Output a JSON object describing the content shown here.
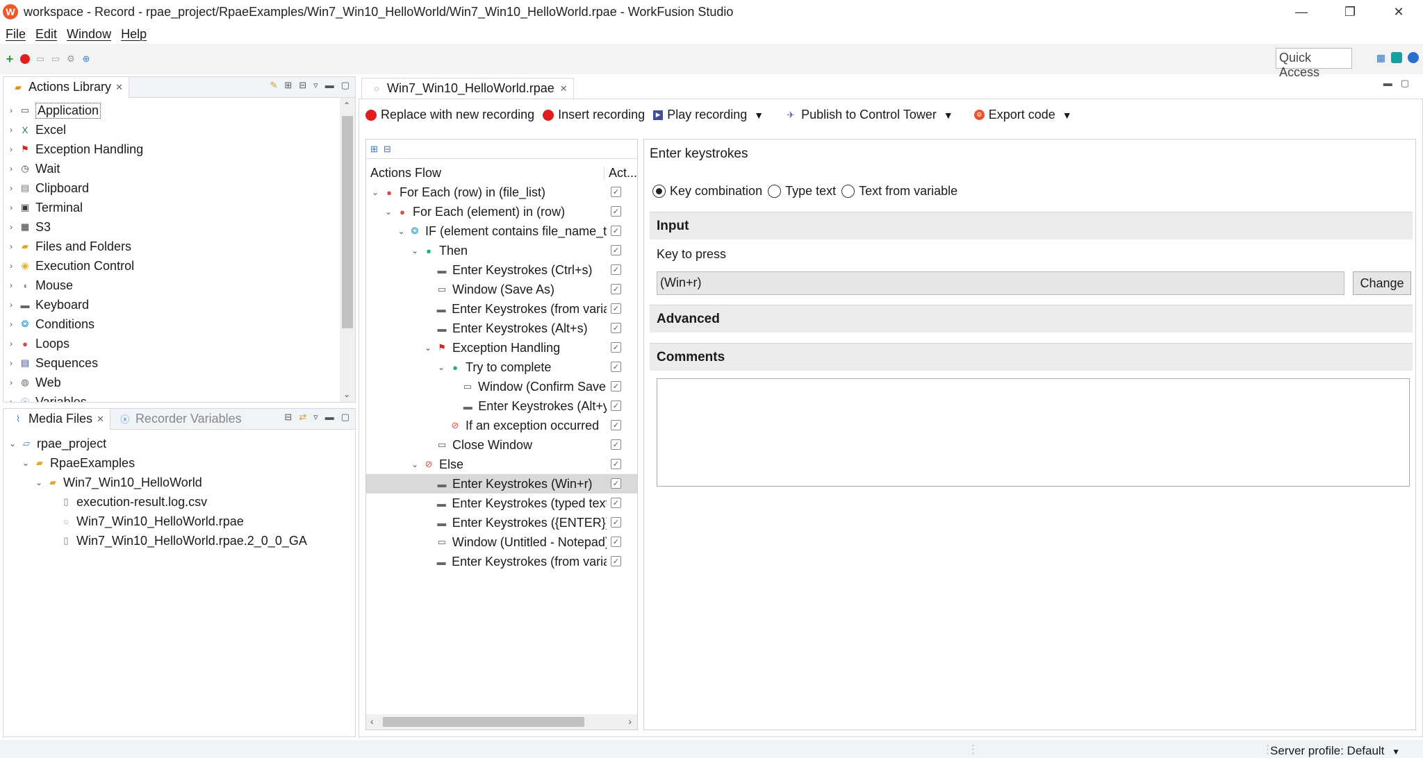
{
  "window": {
    "title": "workspace - Record - rpae_project/RpaeExamples/Win7_Win10_HelloWorld/Win7_Win10_HelloWorld.rpae - WorkFusion Studio",
    "logo_letter": "W",
    "minimize": "—",
    "maximize": "❐",
    "close": "✕"
  },
  "menu": [
    "File",
    "Edit",
    "Window",
    "Help"
  ],
  "toolbar": {
    "quick_access": "Quick Access"
  },
  "actions_library": {
    "tab_label": "Actions Library",
    "items": [
      {
        "label": "Application",
        "icon": "application-icon"
      },
      {
        "label": "Excel",
        "icon": "excel-icon"
      },
      {
        "label": "Exception Handling",
        "icon": "flag-icon"
      },
      {
        "label": "Wait",
        "icon": "clock-icon"
      },
      {
        "label": "Clipboard",
        "icon": "clipboard-icon"
      },
      {
        "label": "Terminal",
        "icon": "terminal-icon"
      },
      {
        "label": "S3",
        "icon": "s3-icon"
      },
      {
        "label": "Files and Folders",
        "icon": "folder-icon"
      },
      {
        "label": "Execution Control",
        "icon": "execution-icon"
      },
      {
        "label": "Mouse",
        "icon": "mouse-icon"
      },
      {
        "label": "Keyboard",
        "icon": "keyboard-icon"
      },
      {
        "label": "Conditions",
        "icon": "conditions-icon"
      },
      {
        "label": "Loops",
        "icon": "loop-icon"
      },
      {
        "label": "Sequences",
        "icon": "sequence-icon"
      },
      {
        "label": "Web",
        "icon": "globe-icon"
      },
      {
        "label": "Variables",
        "icon": "variables-icon"
      }
    ]
  },
  "media_files": {
    "tab_label": "Media Files",
    "tab2_label": "Recorder Variables",
    "tree": [
      {
        "label": "rpae_project",
        "depth": 0,
        "icon": "project-folder-icon",
        "twisty": "⌄"
      },
      {
        "label": "RpaeExamples",
        "depth": 1,
        "icon": "folder-icon",
        "twisty": "⌄"
      },
      {
        "label": "Win7_Win10_HelloWorld",
        "depth": 2,
        "icon": "folder-icon",
        "twisty": "⌄"
      },
      {
        "label": "execution-result.log.csv",
        "depth": 3,
        "icon": "file-icon",
        "twisty": ""
      },
      {
        "label": "Win7_Win10_HelloWorld.rpae",
        "depth": 3,
        "icon": "rpae-file-icon",
        "twisty": ""
      },
      {
        "label": "Win7_Win10_HelloWorld.rpae.2_0_0_GA",
        "depth": 3,
        "icon": "file-icon",
        "twisty": ""
      }
    ]
  },
  "editor": {
    "tab_label": "Win7_Win10_HelloWorld.rpae",
    "actions": {
      "replace": "Replace with new recording",
      "insert": "Insert recording",
      "play": "Play recording",
      "publish": "Publish to Control Tower",
      "export": "Export code"
    }
  },
  "flow": {
    "header_name": "Actions Flow",
    "header_active": "Act...",
    "rows": [
      {
        "label": "For Each (row) in (file_list)",
        "depth": 0,
        "twisty": "⌄",
        "icon": "loop-icon",
        "checked": true
      },
      {
        "label": "For Each (element) in (row)",
        "depth": 1,
        "twisty": "⌄",
        "icon": "loop-icon",
        "checked": true
      },
      {
        "label": "IF (element contains file_name_ten",
        "depth": 2,
        "twisty": "⌄",
        "icon": "conditions-icon",
        "checked": true
      },
      {
        "label": "Then",
        "depth": 3,
        "twisty": "⌄",
        "icon": "then-icon",
        "checked": true
      },
      {
        "label": "Enter Keystrokes (Ctrl+s)",
        "depth": 4,
        "twisty": "",
        "icon": "keyboard-icon",
        "checked": true
      },
      {
        "label": "Window (Save As)",
        "depth": 4,
        "twisty": "",
        "icon": "window-icon",
        "checked": true
      },
      {
        "label": "Enter Keystrokes (from variab",
        "depth": 4,
        "twisty": "",
        "icon": "keyboard-icon",
        "checked": true
      },
      {
        "label": "Enter Keystrokes (Alt+s)",
        "depth": 4,
        "twisty": "",
        "icon": "keyboard-icon",
        "checked": true
      },
      {
        "label": "Exception Handling",
        "depth": 4,
        "twisty": "⌄",
        "icon": "flag-icon",
        "checked": true
      },
      {
        "label": "Try to complete",
        "depth": 5,
        "twisty": "⌄",
        "icon": "then-icon",
        "checked": true
      },
      {
        "label": "Window (Confirm Save A",
        "depth": 6,
        "twisty": "",
        "icon": "window-icon",
        "checked": true
      },
      {
        "label": "Enter Keystrokes (Alt+y)",
        "depth": 6,
        "twisty": "",
        "icon": "keyboard-icon",
        "checked": true
      },
      {
        "label": "If an exception occurred",
        "depth": 5,
        "twisty": "",
        "icon": "exception-icon",
        "checked": true
      },
      {
        "label": "Close Window",
        "depth": 4,
        "twisty": "",
        "icon": "window-icon",
        "checked": true
      },
      {
        "label": "Else",
        "depth": 3,
        "twisty": "⌄",
        "icon": "else-icon",
        "checked": true
      },
      {
        "label": "Enter Keystrokes (Win+r)",
        "depth": 4,
        "twisty": "",
        "icon": "keyboard-icon",
        "checked": true,
        "selected": true
      },
      {
        "label": "Enter Keystrokes (typed text)",
        "depth": 4,
        "twisty": "",
        "icon": "keyboard-icon",
        "checked": true
      },
      {
        "label": "Enter Keystrokes ({ENTER})",
        "depth": 4,
        "twisty": "",
        "icon": "keyboard-icon",
        "checked": true
      },
      {
        "label": "Window (Untitled - Notepad)",
        "depth": 4,
        "twisty": "",
        "icon": "window-icon",
        "checked": true
      },
      {
        "label": "Enter Keystrokes (from variab",
        "depth": 4,
        "twisty": "",
        "icon": "keyboard-icon",
        "checked": true
      }
    ]
  },
  "detail": {
    "title": "Enter keystrokes",
    "radio_options": [
      {
        "label": "Key combination",
        "selected": true
      },
      {
        "label": "Type text",
        "selected": false
      },
      {
        "label": "Text from variable",
        "selected": false
      }
    ],
    "input_section": "Input",
    "key_label": "Key to press",
    "key_value": "(Win+r)",
    "change_button": "Change",
    "advanced_section": "Advanced",
    "comments_section": "Comments",
    "comments_value": ""
  },
  "status": {
    "server_profile": "Server profile: Default"
  }
}
